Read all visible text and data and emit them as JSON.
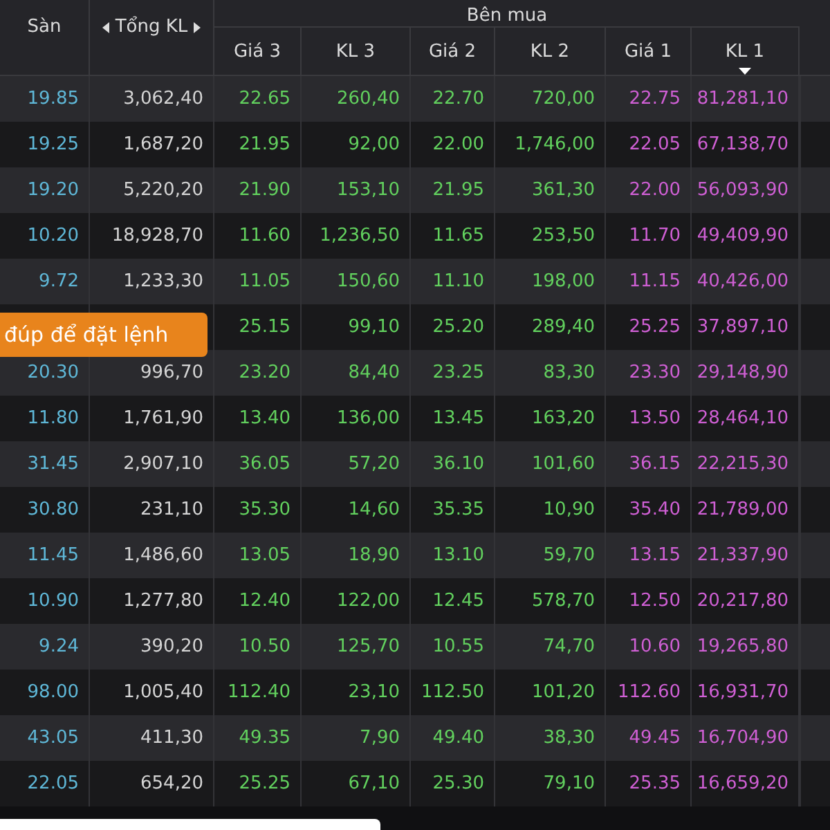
{
  "header": {
    "group_label": "Bên mua",
    "columns": [
      {
        "label": "Sàn",
        "sorted": false
      },
      {
        "label": "Tổng KL",
        "sorted": false,
        "arrows": true
      },
      {
        "label": "Giá 3",
        "sorted": false
      },
      {
        "label": "KL 3",
        "sorted": false
      },
      {
        "label": "Giá 2",
        "sorted": false
      },
      {
        "label": "KL 2",
        "sorted": false
      },
      {
        "label": "Giá 1",
        "sorted": false
      },
      {
        "label": "KL 1",
        "sorted": true
      }
    ]
  },
  "rows": [
    [
      "19.85",
      "3,062,40",
      "22.65",
      "260,40",
      "22.70",
      "720,00",
      "22.75",
      "81,281,10"
    ],
    [
      "19.25",
      "1,687,20",
      "21.95",
      "92,00",
      "22.00",
      "1,746,00",
      "22.05",
      "67,138,70"
    ],
    [
      "19.20",
      "5,220,20",
      "21.90",
      "153,10",
      "21.95",
      "361,30",
      "22.00",
      "56,093,90"
    ],
    [
      "10.20",
      "18,928,70",
      "11.60",
      "1,236,50",
      "11.65",
      "253,50",
      "11.70",
      "49,409,90"
    ],
    [
      "9.72",
      "1,233,30",
      "11.05",
      "150,60",
      "11.10",
      "198,00",
      "11.15",
      "40,426,00"
    ],
    [
      null,
      null,
      "25.15",
      "99,10",
      "25.20",
      "289,40",
      "25.25",
      "37,897,10"
    ],
    [
      "20.30",
      "996,70",
      "23.20",
      "84,40",
      "23.25",
      "83,30",
      "23.30",
      "29,148,90"
    ],
    [
      "11.80",
      "1,761,90",
      "13.40",
      "136,00",
      "13.45",
      "163,20",
      "13.50",
      "28,464,10"
    ],
    [
      "31.45",
      "2,907,10",
      "36.05",
      "57,20",
      "36.10",
      "101,60",
      "36.15",
      "22,215,30"
    ],
    [
      "30.80",
      "231,10",
      "35.30",
      "14,60",
      "35.35",
      "10,90",
      "35.40",
      "21,789,00"
    ],
    [
      "11.45",
      "1,486,60",
      "13.05",
      "18,90",
      "13.10",
      "59,70",
      "13.15",
      "21,337,90"
    ],
    [
      "10.90",
      "1,277,80",
      "12.40",
      "122,00",
      "12.45",
      "578,70",
      "12.50",
      "20,217,80"
    ],
    [
      "9.24",
      "390,20",
      "10.50",
      "125,70",
      "10.55",
      "74,70",
      "10.60",
      "19,265,80"
    ],
    [
      "98.00",
      "1,005,40",
      "112.40",
      "23,10",
      "112.50",
      "101,20",
      "112.60",
      "16,931,70"
    ],
    [
      "43.05",
      "411,30",
      "49.35",
      "7,90",
      "49.40",
      "38,30",
      "49.45",
      "16,704,90"
    ],
    [
      "22.05",
      "654,20",
      "25.25",
      "67,10",
      "25.30",
      "79,10",
      "25.35",
      "16,659,20"
    ]
  ],
  "tooltip": {
    "text": "đúp để đặt lệnh"
  }
}
